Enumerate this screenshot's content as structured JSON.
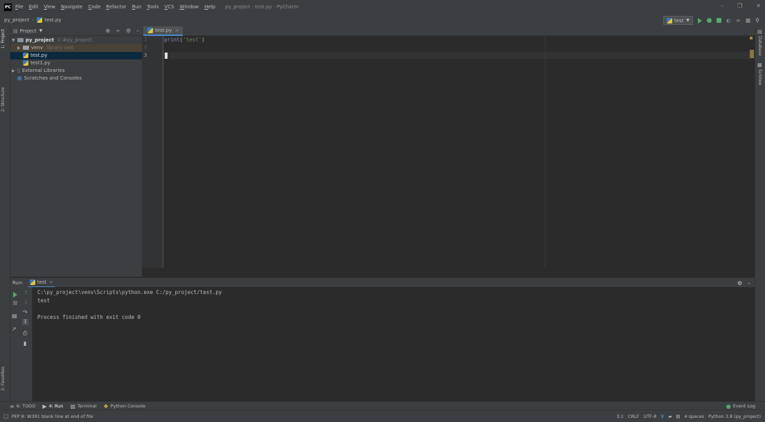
{
  "menu": {
    "items": [
      "File",
      "Edit",
      "View",
      "Navigate",
      "Code",
      "Refactor",
      "Run",
      "Tools",
      "VCS",
      "Window",
      "Help"
    ],
    "window_title": "py_project - test.py - PyCharm"
  },
  "navbar": {
    "project": "py_project",
    "file": "test.py",
    "run_config": "test"
  },
  "left_stripe": {
    "project_tab": "1: Project",
    "structure_tab": "2: Structure",
    "favorites_tab": "2: Favorites"
  },
  "right_stripe": {
    "database_tab": "Database",
    "sciview_tab": "SciView"
  },
  "project_panel": {
    "title": "Project",
    "tree": [
      {
        "label": "py_project",
        "hint": "C:#py_project",
        "indent": 0
      },
      {
        "label": "venv",
        "hint": "library root",
        "indent": 1
      },
      {
        "label": "test.py",
        "hint": "",
        "indent": 2
      },
      {
        "label": "test1.py",
        "hint": "",
        "indent": 2
      },
      {
        "label": "External Libraries",
        "hint": "",
        "indent": 0
      },
      {
        "label": "Scratches and Consoles",
        "hint": "",
        "indent": 0
      }
    ]
  },
  "editor": {
    "tab": "test.py",
    "line_numbers": [
      "1",
      "2",
      "3"
    ],
    "code_lines": [
      "print('test')",
      "",
      ""
    ]
  },
  "run_panel": {
    "label": "Run:",
    "tab": "test",
    "console": [
      "C:\\py_project\\venv\\Scripts\\python.exe C:/py_project/test.py",
      "test",
      "",
      "Process finished with exit code 0"
    ]
  },
  "bottom_tabs": {
    "todo": "6: TODO",
    "run": "4: Run",
    "terminal": "Terminal",
    "python_console": "Python Console",
    "event_log": "Event Log"
  },
  "status": {
    "message": "PEP 8: W391 blank line at end of file",
    "position": "3:1",
    "line_sep": "CRLF",
    "encoding": "UTF-8",
    "indent": "4 spaces",
    "interpreter": "Python 3.8 (py_project)"
  }
}
